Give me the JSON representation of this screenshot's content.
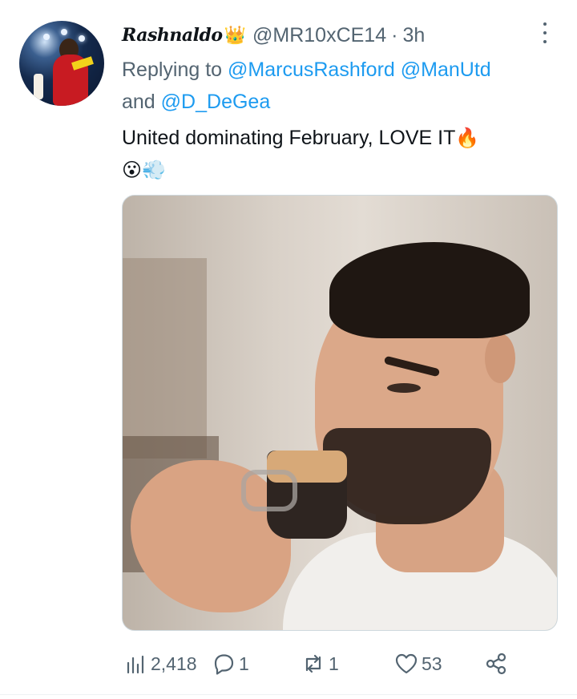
{
  "tweet": {
    "display_name": "Rashnaldo",
    "crown_emoji": "👑",
    "handle": "@MR10xCE14",
    "separator": "·",
    "time": "3h",
    "replying_prefix": "Replying to",
    "mention_1": "@MarcusRashford",
    "mention_2": "@ManUtd",
    "and_word": "and",
    "mention_3": "@D_DeGea",
    "text": "United dominating February, LOVE IT",
    "emoji_fire": "🔥",
    "emoji_face": "😮",
    "emoji_puff": "💨"
  },
  "actions": {
    "views": "2,418",
    "replies": "1",
    "retweets": "1",
    "likes": "53"
  },
  "icons": {
    "more": "more-icon",
    "views": "analytics-icon",
    "reply": "reply-icon",
    "retweet": "retweet-icon",
    "like": "heart-icon",
    "share": "share-icon"
  },
  "colors": {
    "link": "#1d9bf0",
    "muted": "#536471",
    "text": "#0f1419"
  }
}
